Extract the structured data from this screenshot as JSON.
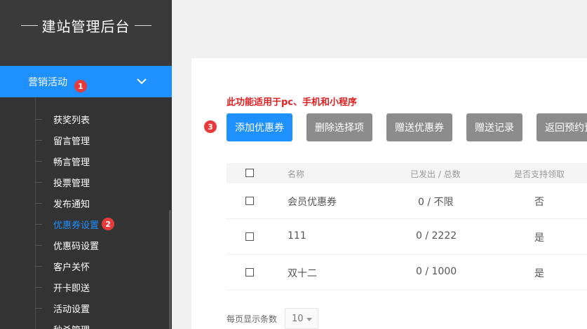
{
  "sidebar": {
    "logo_title": "建站管理后台",
    "active_menu": {
      "label": "营销活动",
      "badge": "1",
      "icon": "chevron-down-icon"
    },
    "submenu": [
      {
        "label": "获奖列表",
        "selected": false
      },
      {
        "label": "留言管理",
        "selected": false
      },
      {
        "label": "畅言管理",
        "selected": false
      },
      {
        "label": "投票管理",
        "selected": false
      },
      {
        "label": "发布通知",
        "selected": false
      },
      {
        "label": "优惠券设置",
        "selected": true,
        "badge": "2"
      },
      {
        "label": "优惠码设置",
        "selected": false
      },
      {
        "label": "客户关怀",
        "selected": false
      },
      {
        "label": "开卡即送",
        "selected": false
      },
      {
        "label": "活动设置",
        "selected": false
      },
      {
        "label": "秒杀管理",
        "selected": false
      }
    ]
  },
  "main": {
    "notice": "此功能适用于pc、手机和小程序",
    "toolbar_badge": "3",
    "buttons": {
      "add": "添加优惠券",
      "delete": "删除选择项",
      "gift": "赠送优惠券",
      "records": "赠送记录",
      "back": "返回预约预"
    },
    "table": {
      "headers": {
        "name": "名称",
        "issued": "已发出 / 总数",
        "claimable": "是否支持领取"
      },
      "rows": [
        {
          "name": "会员优惠券",
          "issued": "0 / 不限",
          "claimable": "否"
        },
        {
          "name": "111",
          "issued": "0 / 2222",
          "claimable": "是"
        },
        {
          "name": "双十二",
          "issued": "0 / 1000",
          "claimable": "是"
        }
      ]
    },
    "pager": {
      "label": "每页显示条数",
      "page_size": "10"
    }
  },
  "colors": {
    "accent": "#1e90ff",
    "sidebar_bg": "#333333",
    "badge": "#e83a3a",
    "notice": "#e02020",
    "gray_button": "#8c8c8c"
  }
}
